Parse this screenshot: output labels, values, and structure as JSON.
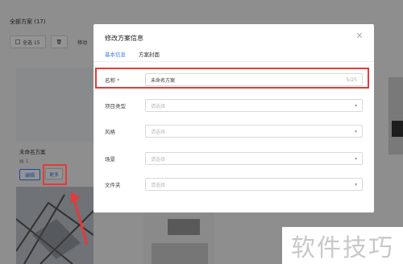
{
  "background": {
    "title": "全部方案 (17)",
    "toolbar": [
      {
        "label": "全选 15"
      },
      {
        "label": "🗑"
      },
      {
        "label": "移动"
      }
    ],
    "card": {
      "title": "未命名方案",
      "meta": "▤ 1",
      "edit_label": "编辑",
      "more_label": "更多"
    }
  },
  "modal": {
    "title": "修改方案信息",
    "tabs": [
      {
        "label": "基本信息",
        "active": true
      },
      {
        "label": "方案封面",
        "active": false
      }
    ],
    "fields": {
      "name": {
        "label": "名称",
        "required_mark": "*",
        "value": "未命名方案",
        "counter": "5/25"
      },
      "project_type": {
        "label": "项目类型",
        "placeholder": "请选择"
      },
      "style": {
        "label": "风格",
        "placeholder": "请选择"
      },
      "scene": {
        "label": "场景",
        "placeholder": "请选择"
      },
      "folder": {
        "label": "文件夹",
        "placeholder": "请选择"
      }
    }
  },
  "watermark": "软件技巧",
  "colors": {
    "accent": "#3a7bff",
    "highlight_red": "#e53a3a"
  }
}
